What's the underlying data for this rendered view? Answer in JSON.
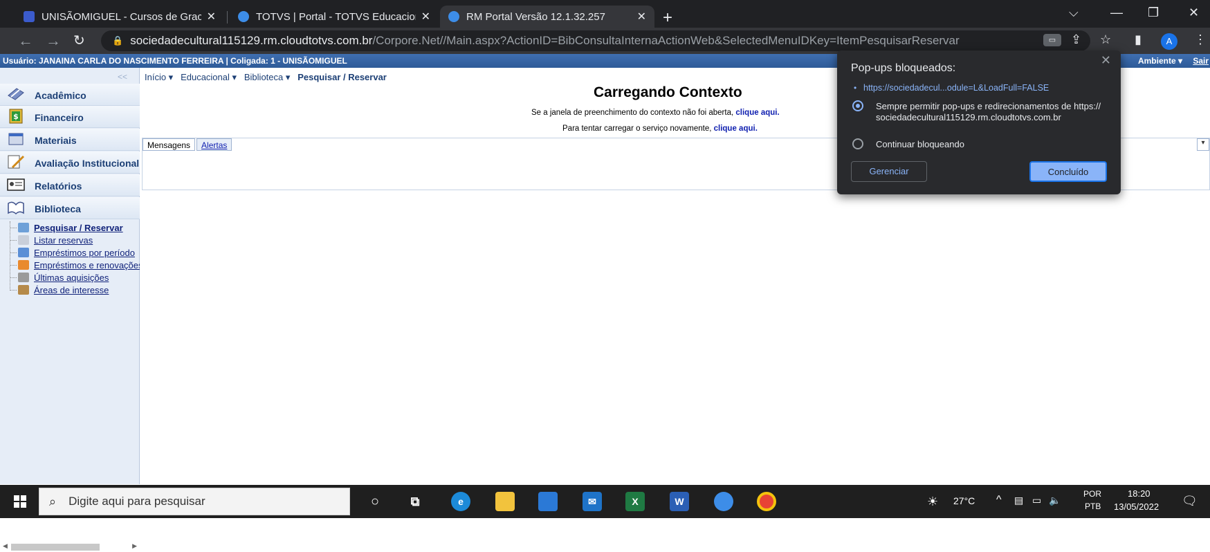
{
  "browser": {
    "tabs": [
      {
        "title": "UNISÃOMIGUEL - Cursos de Grac",
        "favicon_color": "#3b5bcc"
      },
      {
        "title": "TOTVS | Portal - TOTVS Educacion",
        "favicon_color": "#3d8de8"
      },
      {
        "title": "RM Portal Versão 12.1.32.257",
        "favicon_color": "#3d8de8"
      }
    ],
    "url_host": "sociedadecultural115129.rm.cloudtotvs.com.br",
    "url_path": "/Corpore.Net//Main.aspx?ActionID=BibConsultaInternaActionWeb&SelectedMenuIDKey=ItemPesquisarReservar",
    "profile_initial": "A"
  },
  "portal": {
    "user_line": "Usuário: JANAINA CARLA DO NASCIMENTO FERREIRA  |  Coligada: 1 - UNISÃOMIGUEL",
    "env_label": "Ambiente ▾",
    "exit_label": "Sair",
    "collapse_label": "<<"
  },
  "sidebar": {
    "modules": [
      {
        "label": "Acadêmico",
        "icon": "academic-icon"
      },
      {
        "label": "Financeiro",
        "icon": "finance-icon"
      },
      {
        "label": "Materiais",
        "icon": "materials-icon"
      },
      {
        "label": "Avaliação Institucional",
        "icon": "evaluation-icon"
      },
      {
        "label": "Relatórios",
        "icon": "reports-icon"
      },
      {
        "label": "Biblioteca",
        "icon": "library-icon"
      }
    ],
    "library_items": [
      {
        "label": "Pesquisar / Reservar",
        "selected": true
      },
      {
        "label": "Listar reservas"
      },
      {
        "label": "Empréstimos por período"
      },
      {
        "label": "Empréstimos e renovações"
      },
      {
        "label": "Últimas aquisições"
      },
      {
        "label": "Áreas de interesse"
      }
    ]
  },
  "breadcrumb": {
    "items": [
      "Início ▾",
      "Educacional ▾",
      "Biblioteca ▾"
    ],
    "current": "Pesquisar / Reservar"
  },
  "context": {
    "title": "Carregando Contexto",
    "line1": "Se a janela de preenchimento do contexto não foi aberta,",
    "line1_link": "clique aqui.",
    "line2": "Para tentar carregar o serviço novamente,",
    "line2_link": "clique aqui."
  },
  "panel": {
    "tabs": [
      "Mensagens",
      "Alertas"
    ]
  },
  "popup": {
    "title": "Pop-ups bloqueados:",
    "blocked_url": "https://sociedadecul...odule=L&LoadFull=FALSE",
    "option_allow": "Sempre permitir pop-ups e redirecionamentos de https:// sociedadecultural115129.rm.cloudtotvs.com.br",
    "option_block": "Continuar bloqueando",
    "manage_label": "Gerenciar",
    "done_label": "Concluído"
  },
  "taskbar": {
    "search_placeholder": "Digite aqui para pesquisar",
    "temperature": "27°C",
    "lang_top": "POR",
    "lang_bottom": "PTB",
    "time": "18:20",
    "date": "13/05/2022"
  }
}
